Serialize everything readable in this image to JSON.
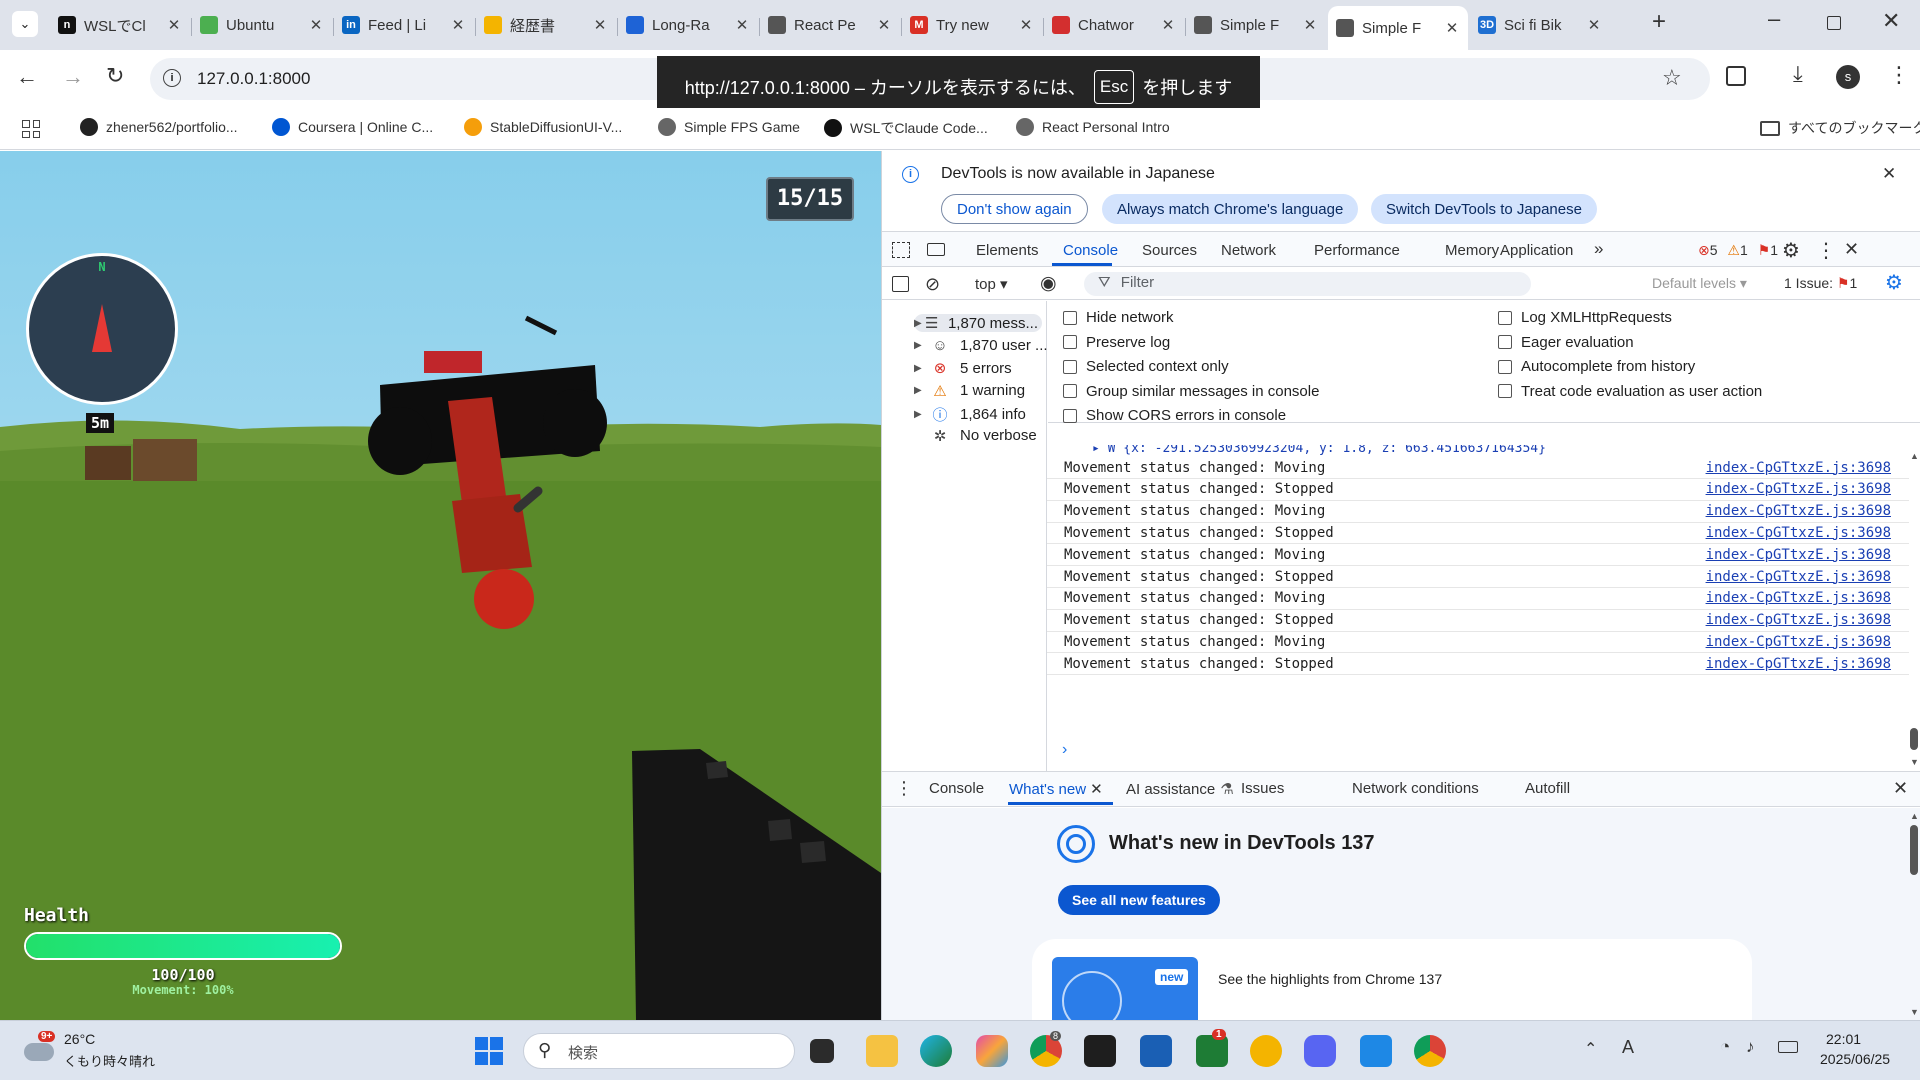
{
  "tabs": [
    {
      "title": "WSLでCl",
      "fav": "n",
      "color": "#111111"
    },
    {
      "title": "Ubuntu",
      "fav": "",
      "color": "#4caf50"
    },
    {
      "title": "Feed | Li",
      "fav": "in",
      "color": "#0a66c2"
    },
    {
      "title": "経歴書",
      "fav": "",
      "color": "#f4b400"
    },
    {
      "title": "Long-Ra",
      "fav": "",
      "color": "#1e63d6"
    },
    {
      "title": "React Pe",
      "fav": "",
      "color": "#555555"
    },
    {
      "title": "Try new",
      "fav": "M",
      "color": "#d93025"
    },
    {
      "title": "Chatwor",
      "fav": "",
      "color": "#d32f2f"
    },
    {
      "title": "Simple F",
      "fav": "",
      "color": "#555555"
    },
    {
      "title": "Simple F",
      "fav": "",
      "color": "#555555"
    },
    {
      "title": "Sci fi Bik",
      "fav": "3D",
      "color": "#1f6fd1"
    }
  ],
  "address": "127.0.0.1:8000",
  "toast": {
    "before": "http://127.0.0.1:8000 – カーソルを表示するには、",
    "key": "Esc",
    "after": "を押します"
  },
  "bookmarks": [
    {
      "label": "zhener562/portfolio...",
      "color": "#222222"
    },
    {
      "label": "Coursera | Online C...",
      "color": "#0056d2"
    },
    {
      "label": "StableDiffusionUI-V...",
      "color": "#f59e0b"
    },
    {
      "label": "Simple FPS Game",
      "color": "#666666"
    },
    {
      "label": "WSLでClaude Code...",
      "color": "#111111"
    },
    {
      "label": "React Personal Intro",
      "color": "#666666"
    }
  ],
  "all_bookmarks": "すべてのブックマーク",
  "profile_initial": "s",
  "game": {
    "ammo": "15/15",
    "compass_n": "N",
    "distance": "5m",
    "health_label": "Health",
    "health_value": "100/100",
    "health_fraction": 1.0,
    "movement": "Movement: 100%"
  },
  "devtools": {
    "banner": "DevTools is now available in Japanese",
    "btn_dont_show": "Don't show again",
    "btn_always_match": "Always match Chrome's language",
    "btn_switch": "Switch DevTools to Japanese",
    "tabs": [
      "Elements",
      "Console",
      "Sources",
      "Network",
      "Performance",
      "Memory",
      "Application"
    ],
    "error_count": "5",
    "warning_count": "1",
    "issue_count": "1",
    "context": "top",
    "filter_placeholder": "Filter",
    "default_levels": "Default levels",
    "issues_label": "1 Issue:",
    "issues_num": "1",
    "sidebar": [
      {
        "label": "1,870 mess...",
        "icon": "☰",
        "color": "#444444"
      },
      {
        "label": "1,870 user ...",
        "icon": "☺",
        "color": "#444444"
      },
      {
        "label": "5 errors",
        "icon": "⊗",
        "color": "#d93025"
      },
      {
        "label": "1 warning",
        "icon": "⚠",
        "color": "#e37400"
      },
      {
        "label": "1,864 info",
        "icon": "ⓘ",
        "color": "#1a73e8"
      },
      {
        "label": "No verbose",
        "icon": "✲",
        "color": "#444444"
      }
    ],
    "settings_left": [
      "Hide network",
      "Preserve log",
      "Selected context only",
      "Group similar messages in console",
      "Show CORS errors in console"
    ],
    "settings_right": [
      "Log XMLHttpRequests",
      "Eager evaluation",
      "Autocomplete from history",
      "Treat code evaluation as user action"
    ],
    "partial_row": "▸ W {x: -291.52530369923204, y: 1.8, z: 663.4516637164354}",
    "log_source": "index-CpGTtxzE.js:3698",
    "logs": [
      "Movement status changed: Moving",
      "Movement status changed: Stopped",
      "Movement status changed: Moving",
      "Movement status changed: Stopped",
      "Movement status changed: Moving",
      "Movement status changed: Stopped",
      "Movement status changed: Moving",
      "Movement status changed: Stopped",
      "Movement status changed: Moving",
      "Movement status changed: Stopped"
    ],
    "drawer_tabs": [
      "Console",
      "What's new",
      "AI assistance",
      "Issues",
      "Network conditions",
      "Autofill"
    ],
    "whats_new_title": "What's new in DevTools 137",
    "see_all": "See all new features",
    "new_badge": "new",
    "highlights": "See the highlights from Chrome 137"
  },
  "taskbar": {
    "weather_badge": "9+",
    "temp": "26°C",
    "weather": "くもり時々晴れ",
    "search": "検索",
    "time": "22:01",
    "date": "2025/06/25",
    "chrome_badge": "8",
    "xbox_badge": "1"
  }
}
